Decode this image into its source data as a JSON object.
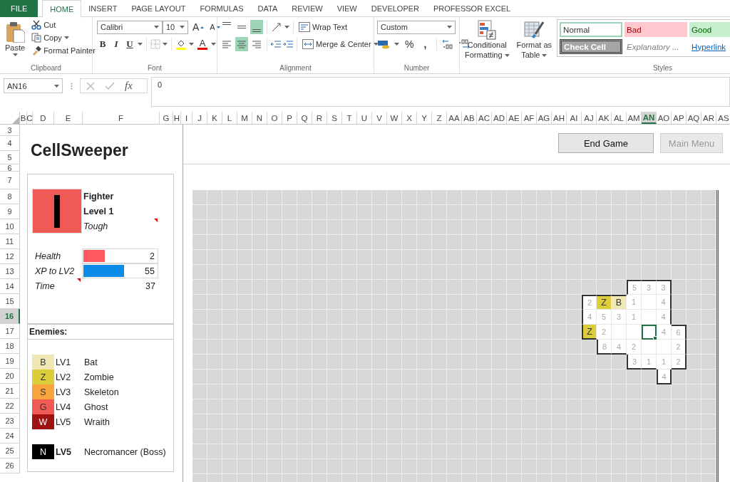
{
  "ribbon_tabs": [
    {
      "label": "FILE",
      "kind": "file",
      "selected": false
    },
    {
      "label": "HOME",
      "kind": "tab",
      "selected": true
    },
    {
      "label": "INSERT",
      "kind": "tab",
      "selected": false
    },
    {
      "label": "PAGE LAYOUT",
      "kind": "tab",
      "selected": false
    },
    {
      "label": "FORMULAS",
      "kind": "tab",
      "selected": false
    },
    {
      "label": "DATA",
      "kind": "tab",
      "selected": false
    },
    {
      "label": "REVIEW",
      "kind": "tab",
      "selected": false
    },
    {
      "label": "VIEW",
      "kind": "tab",
      "selected": false
    },
    {
      "label": "DEVELOPER",
      "kind": "tab",
      "selected": false
    },
    {
      "label": "PROFESSOR EXCEL",
      "kind": "tab",
      "selected": false
    }
  ],
  "clipboard": {
    "label": "Clipboard",
    "paste": "Paste",
    "cut": "Cut",
    "copy": "Copy",
    "format_painter": "Format Painter"
  },
  "font": {
    "label": "Font",
    "name": "Calibri",
    "size": "10",
    "grow": "A",
    "shrink": "A",
    "bold": "B",
    "italic": "I",
    "underline": "U",
    "color_button": "A"
  },
  "alignment": {
    "label": "Alignment",
    "wrap_text": "Wrap Text",
    "merge_center": "Merge & Center",
    "vertical": [
      {
        "selected": false
      },
      {
        "selected": false
      },
      {
        "selected": true
      }
    ],
    "horizontal": [
      {
        "selected": false
      },
      {
        "selected": true
      },
      {
        "selected": false
      }
    ]
  },
  "number": {
    "label": "Number",
    "format": "Custom",
    "percent": "%",
    "comma": ","
  },
  "styles": {
    "label": "Styles",
    "conditional": [
      "Conditional",
      "Formatting"
    ],
    "format_table": [
      "Format as",
      "Table"
    ],
    "gallery": [
      {
        "label": "Normal",
        "kind": "normal"
      },
      {
        "label": "Bad",
        "kind": "bad"
      },
      {
        "label": "Good",
        "kind": "good"
      },
      {
        "label": "Check Cell",
        "kind": "check"
      },
      {
        "label": "Explanatory ...",
        "kind": "explanatory"
      },
      {
        "label": "Hyperlink",
        "kind": "hyperlink"
      }
    ]
  },
  "formula_bar": {
    "name_box": "AN16",
    "fx": "fx",
    "value": "0"
  },
  "columns": [
    {
      "label": "B",
      "selected": false
    },
    {
      "label": "C",
      "selected": false
    },
    {
      "label": "D",
      "selected": false
    },
    {
      "label": "E",
      "selected": false
    },
    {
      "label": "F",
      "selected": false
    },
    {
      "label": "G",
      "selected": false
    },
    {
      "label": "H",
      "selected": false
    },
    {
      "label": "I",
      "selected": false
    },
    {
      "label": "J",
      "selected": false
    },
    {
      "label": "K",
      "selected": false
    },
    {
      "label": "L",
      "selected": false
    },
    {
      "label": "M",
      "selected": false
    },
    {
      "label": "N",
      "selected": false
    },
    {
      "label": "O",
      "selected": false
    },
    {
      "label": "P",
      "selected": false
    },
    {
      "label": "Q",
      "selected": false
    },
    {
      "label": "R",
      "selected": false
    },
    {
      "label": "S",
      "selected": false
    },
    {
      "label": "T",
      "selected": false
    },
    {
      "label": "U",
      "selected": false
    },
    {
      "label": "V",
      "selected": false
    },
    {
      "label": "W",
      "selected": false
    },
    {
      "label": "X",
      "selected": false
    },
    {
      "label": "Y",
      "selected": false
    },
    {
      "label": "Z",
      "selected": false
    },
    {
      "label": "AA",
      "selected": false
    },
    {
      "label": "AB",
      "selected": false
    },
    {
      "label": "AC",
      "selected": false
    },
    {
      "label": "AD",
      "selected": false
    },
    {
      "label": "AE",
      "selected": false
    },
    {
      "label": "AF",
      "selected": false
    },
    {
      "label": "AG",
      "selected": false
    },
    {
      "label": "AH",
      "selected": false
    },
    {
      "label": "AI",
      "selected": false
    },
    {
      "label": "AJ",
      "selected": false
    },
    {
      "label": "AK",
      "selected": false
    },
    {
      "label": "AL",
      "selected": false
    },
    {
      "label": "AM",
      "selected": false
    },
    {
      "label": "AN",
      "selected": true
    },
    {
      "label": "AO",
      "selected": false
    },
    {
      "label": "AP",
      "selected": false
    },
    {
      "label": "AQ",
      "selected": false
    },
    {
      "label": "AR",
      "selected": false
    },
    {
      "label": "AS",
      "selected": false
    }
  ],
  "rows": [
    {
      "label": "3",
      "selected": false
    },
    {
      "label": "4",
      "selected": false
    },
    {
      "label": "5",
      "selected": false
    },
    {
      "label": "6",
      "selected": false
    },
    {
      "label": "7",
      "selected": false
    },
    {
      "label": "8",
      "selected": false
    },
    {
      "label": "9",
      "selected": false
    },
    {
      "label": "10",
      "selected": false
    },
    {
      "label": "11",
      "selected": false
    },
    {
      "label": "12",
      "selected": false
    },
    {
      "label": "13",
      "selected": false
    },
    {
      "label": "14",
      "selected": false
    },
    {
      "label": "15",
      "selected": false
    },
    {
      "label": "16",
      "selected": true
    },
    {
      "label": "17",
      "selected": false
    },
    {
      "label": "18",
      "selected": false
    },
    {
      "label": "19",
      "selected": false
    },
    {
      "label": "20",
      "selected": false
    },
    {
      "label": "21",
      "selected": false
    },
    {
      "label": "22",
      "selected": false
    },
    {
      "label": "23",
      "selected": false
    },
    {
      "label": "24",
      "selected": false
    },
    {
      "label": "25",
      "selected": false
    },
    {
      "label": "26",
      "selected": false
    }
  ],
  "game": {
    "title": "CellSweeper",
    "buttons": [
      {
        "label": "End Game",
        "disabled": false
      },
      {
        "label": "Main Menu",
        "disabled": true
      }
    ],
    "hero": {
      "class": "Fighter",
      "level": "Level 1",
      "trait": "Tough",
      "trait_note": true
    },
    "stats": [
      {
        "label": "Health",
        "kind": "bar",
        "level": 0.29,
        "color": "#ff5a5f",
        "value": "2",
        "note": false
      },
      {
        "label": "XP to LV2",
        "kind": "bar",
        "level": 0.54,
        "color": "#0a8ce8",
        "value": "55",
        "note": false
      },
      {
        "label": "Time",
        "kind": "plain",
        "value": "37",
        "note": true
      }
    ],
    "enemies": {
      "title": "Enemies:",
      "items": [
        {
          "glyph": "B",
          "level": "LV1",
          "name": "Bat",
          "color": "#f0e8b4",
          "boss": false
        },
        {
          "glyph": "Z",
          "level": "LV2",
          "name": "Zombie",
          "color": "#dccd3c",
          "boss": false
        },
        {
          "glyph": "S",
          "level": "LV3",
          "name": "Skeleton",
          "color": "#f9a33c",
          "boss": false
        },
        {
          "glyph": "G",
          "level": "LV4",
          "name": "Ghost",
          "color": "#f05a55",
          "boss": false
        },
        {
          "glyph": "W",
          "level": "LV5",
          "name": "Wraith",
          "color": "#a01212",
          "boss": false
        },
        {
          "glyph": "N",
          "level": "LV5",
          "name": "Necromancer (Boss)",
          "color": "#000000",
          "boss": true
        }
      ]
    },
    "board": {
      "rows": [
        {
          "open": [
            false,
            false,
            false,
            false,
            false,
            false,
            false,
            false,
            false,
            false,
            false,
            false,
            false,
            false,
            false,
            false,
            false,
            false,
            false,
            false,
            false,
            false,
            false,
            false,
            false,
            false,
            false,
            false,
            false,
            false,
            false,
            false,
            false,
            false,
            false
          ]
        },
        {
          "open": [
            false,
            false,
            false,
            false,
            false,
            false,
            false,
            false,
            false,
            false,
            false,
            false,
            false,
            false,
            false,
            false,
            false,
            false,
            false,
            false,
            false,
            false,
            false,
            false,
            false,
            false,
            false,
            false,
            false,
            false,
            false,
            false,
            false,
            false,
            false
          ]
        },
        {
          "open": [
            false,
            false,
            false,
            false,
            false,
            false,
            false,
            false,
            false,
            false,
            false,
            false,
            false,
            false,
            false,
            false,
            false,
            false,
            false,
            false,
            false,
            false,
            false,
            false,
            false,
            false,
            false,
            false,
            false,
            false,
            false,
            false,
            false,
            false,
            false
          ]
        },
        {
          "open": [
            false,
            false,
            false,
            false,
            false,
            false,
            false,
            false,
            false,
            false,
            false,
            false,
            false,
            false,
            false,
            false,
            false,
            false,
            false,
            false,
            false,
            false,
            false,
            false,
            false,
            false,
            false,
            false,
            false,
            false,
            false,
            false,
            false,
            false,
            false
          ]
        },
        {
          "open": [
            false,
            false,
            false,
            false,
            false,
            false,
            false,
            false,
            false,
            false,
            false,
            false,
            false,
            false,
            false,
            false,
            false,
            false,
            false,
            false,
            false,
            false,
            false,
            false,
            false,
            false,
            false,
            false,
            false,
            false,
            false,
            false,
            false,
            false,
            false
          ]
        },
        {
          "open": [
            false,
            false,
            false,
            false,
            false,
            false,
            false,
            false,
            false,
            false,
            false,
            false,
            false,
            false,
            false,
            false,
            false,
            false,
            false,
            false,
            false,
            false,
            false,
            false,
            false,
            false,
            false,
            false,
            false,
            false,
            false,
            false,
            false,
            false,
            false
          ]
        },
        {
          "open": [
            false,
            false,
            false,
            false,
            false,
            false,
            false,
            false,
            false,
            false,
            false,
            false,
            false,
            false,
            false,
            false,
            false,
            false,
            false,
            false,
            false,
            false,
            false,
            false,
            false,
            false,
            false,
            false,
            false,
            true,
            true,
            true,
            false,
            false,
            false
          ]
        },
        {
          "open": [
            false,
            false,
            false,
            false,
            false,
            false,
            false,
            false,
            false,
            false,
            false,
            false,
            false,
            false,
            false,
            false,
            false,
            false,
            false,
            false,
            false,
            false,
            false,
            false,
            false,
            false,
            true,
            true,
            true,
            true,
            true,
            true,
            false,
            false,
            false
          ]
        },
        {
          "open": [
            false,
            false,
            false,
            false,
            false,
            false,
            false,
            false,
            false,
            false,
            false,
            false,
            false,
            false,
            false,
            false,
            false,
            false,
            false,
            false,
            false,
            false,
            false,
            false,
            false,
            false,
            true,
            true,
            true,
            true,
            true,
            true,
            false,
            false,
            false
          ]
        },
        {
          "open": [
            false,
            false,
            false,
            false,
            false,
            false,
            false,
            false,
            false,
            false,
            false,
            false,
            false,
            false,
            false,
            false,
            false,
            false,
            false,
            false,
            false,
            false,
            false,
            false,
            false,
            false,
            true,
            true,
            true,
            true,
            true,
            true,
            true,
            false,
            false
          ]
        },
        {
          "open": [
            false,
            false,
            false,
            false,
            false,
            false,
            false,
            false,
            false,
            false,
            false,
            false,
            false,
            false,
            false,
            false,
            false,
            false,
            false,
            false,
            false,
            false,
            false,
            false,
            false,
            false,
            false,
            true,
            true,
            true,
            true,
            true,
            true,
            false,
            false
          ]
        },
        {
          "open": [
            false,
            false,
            false,
            false,
            false,
            false,
            false,
            false,
            false,
            false,
            false,
            false,
            false,
            false,
            false,
            false,
            false,
            false,
            false,
            false,
            false,
            false,
            false,
            false,
            false,
            false,
            false,
            false,
            false,
            true,
            true,
            true,
            true,
            false,
            false
          ]
        },
        {
          "open": [
            false,
            false,
            false,
            false,
            false,
            false,
            false,
            false,
            false,
            false,
            false,
            false,
            false,
            false,
            false,
            false,
            false,
            false,
            false,
            false,
            false,
            false,
            false,
            false,
            false,
            false,
            false,
            false,
            false,
            false,
            false,
            true,
            false,
            false,
            false
          ]
        },
        {
          "open": [
            false,
            false,
            false,
            false,
            false,
            false,
            false,
            false,
            false,
            false,
            false,
            false,
            false,
            false,
            false,
            false,
            false,
            false,
            false,
            false,
            false,
            false,
            false,
            false,
            false,
            false,
            false,
            false,
            false,
            false,
            false,
            false,
            false,
            false,
            false
          ]
        },
        {
          "open": [
            false,
            false,
            false,
            false,
            false,
            false,
            false,
            false,
            false,
            false,
            false,
            false,
            false,
            false,
            false,
            false,
            false,
            false,
            false,
            false,
            false,
            false,
            false,
            false,
            false,
            false,
            false,
            false,
            false,
            false,
            false,
            false,
            false,
            false,
            false
          ]
        },
        {
          "open": [
            false,
            false,
            false,
            false,
            false,
            false,
            false,
            false,
            false,
            false,
            false,
            false,
            false,
            false,
            false,
            false,
            false,
            false,
            false,
            false,
            false,
            false,
            false,
            false,
            false,
            false,
            false,
            false,
            false,
            false,
            false,
            false,
            false,
            false,
            false
          ]
        },
        {
          "open": [
            false,
            false,
            false,
            false,
            false,
            false,
            false,
            false,
            false,
            false,
            false,
            false,
            false,
            false,
            false,
            false,
            false,
            false,
            false,
            false,
            false,
            false,
            false,
            false,
            false,
            false,
            false,
            false,
            false,
            false,
            false,
            false,
            false,
            false,
            false
          ]
        },
        {
          "open": [
            false,
            false,
            false,
            false,
            false,
            false,
            false,
            false,
            false,
            false,
            false,
            false,
            false,
            false,
            false,
            false,
            false,
            false,
            false,
            false,
            false,
            false,
            false,
            false,
            false,
            false,
            false,
            false,
            false,
            false,
            false,
            false,
            false,
            false,
            false
          ]
        },
        {
          "open": [
            false,
            false,
            false,
            false,
            false,
            false,
            false,
            false,
            false,
            false,
            false,
            false,
            false,
            false,
            false,
            false,
            false,
            false,
            false,
            false,
            false,
            false,
            false,
            false,
            false,
            false,
            false,
            false,
            false,
            false,
            false,
            false,
            false,
            false,
            false
          ]
        },
        {
          "open": [
            false,
            false,
            false,
            false,
            false,
            false,
            false,
            false,
            false,
            false,
            false,
            false,
            false,
            false,
            false,
            false,
            false,
            false,
            false,
            false,
            false,
            false,
            false,
            false,
            false,
            false,
            false,
            false,
            false,
            false,
            false,
            false,
            false,
            false,
            false
          ]
        }
      ],
      "cells": [
        {
          "kind": "number",
          "text": "5"
        },
        {
          "kind": "number",
          "text": "3"
        },
        {
          "kind": "number",
          "text": "3"
        },
        {
          "kind": "number",
          "text": "2"
        },
        {
          "kind": "enemy",
          "text": "Z",
          "color": "#dccd3c"
        },
        {
          "kind": "enemy",
          "text": "B",
          "color": "#f0e8b4"
        },
        {
          "kind": "number",
          "text": "1"
        },
        {
          "kind": "blank"
        },
        {
          "kind": "number",
          "text": "4"
        },
        {
          "kind": "number",
          "text": "4"
        },
        {
          "kind": "number",
          "text": "5"
        },
        {
          "kind": "number",
          "text": "3"
        },
        {
          "kind": "number",
          "text": "1"
        },
        {
          "kind": "blank"
        },
        {
          "kind": "number",
          "text": "4"
        },
        {
          "kind": "enemy",
          "text": "Z",
          "color": "#dccd3c"
        },
        {
          "kind": "number",
          "text": "2"
        },
        {
          "kind": "blank"
        },
        {
          "kind": "blank"
        },
        {
          "kind": "cursor"
        },
        {
          "kind": "number",
          "text": "4"
        },
        {
          "kind": "number",
          "text": "6"
        },
        {
          "kind": "number",
          "text": "8"
        },
        {
          "kind": "number",
          "text": "4"
        },
        {
          "kind": "number",
          "text": "2"
        },
        {
          "kind": "blank"
        },
        {
          "kind": "blank"
        },
        {
          "kind": "number",
          "text": "2"
        },
        {
          "kind": "number",
          "text": "3"
        },
        {
          "kind": "number",
          "text": "1"
        },
        {
          "kind": "number",
          "text": "1"
        },
        {
          "kind": "number",
          "text": "2"
        },
        {
          "kind": "number",
          "text": "4"
        }
      ]
    }
  }
}
